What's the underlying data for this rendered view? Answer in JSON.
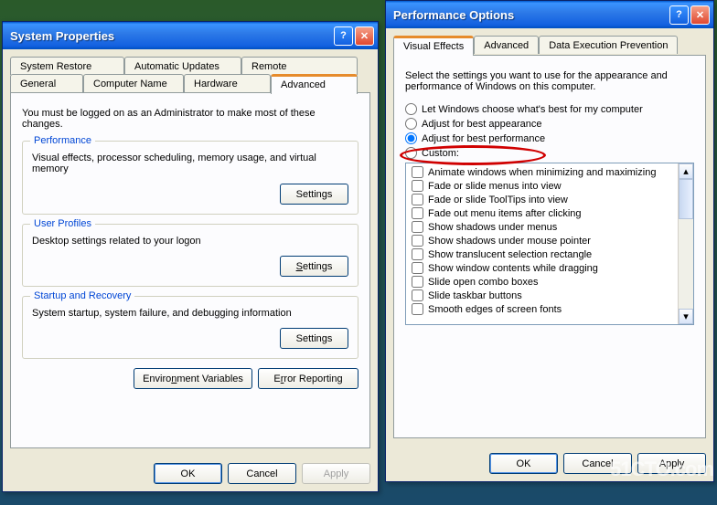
{
  "sysProps": {
    "title": "System Properties",
    "tabs_row1": [
      "System Restore",
      "Automatic Updates",
      "Remote"
    ],
    "tabs_row2": [
      "General",
      "Computer Name",
      "Hardware",
      "Advanced"
    ],
    "instruction": "You must be logged on as an Administrator to make most of these changes.",
    "groups": {
      "performance": {
        "title": "Performance",
        "desc": "Visual effects, processor scheduling, memory usage, and virtual memory",
        "btn": "Settings"
      },
      "userProfiles": {
        "title": "User Profiles",
        "desc": "Desktop settings related to your logon",
        "btn": "Settings"
      },
      "startup": {
        "title": "Startup and Recovery",
        "desc": "System startup, system failure, and debugging information",
        "btn": "Settings"
      }
    },
    "envVars": "Environment Variables",
    "errorReport": "Error Reporting",
    "ok": "OK",
    "cancel": "Cancel",
    "apply": "Apply"
  },
  "perfOpts": {
    "title": "Performance Options",
    "tabs": [
      "Visual Effects",
      "Advanced",
      "Data Execution Prevention"
    ],
    "instruction": "Select the settings you want to use for the appearance and performance of Windows on this computer.",
    "radios": {
      "let": "Let Windows choose what's best for my computer",
      "appearance": "Adjust for best appearance",
      "performance": "Adjust for best performance",
      "custom": "Custom:"
    },
    "checks": [
      "Animate windows when minimizing and maximizing",
      "Fade or slide menus into view",
      "Fade or slide ToolTips into view",
      "Fade out menu items after clicking",
      "Show shadows under menus",
      "Show shadows under mouse pointer",
      "Show translucent selection rectangle",
      "Show window contents while dragging",
      "Slide open combo boxes",
      "Slide taskbar buttons",
      "Smooth edges of screen fonts"
    ],
    "ok": "OK",
    "cancel": "Cancel",
    "apply": "Apply"
  },
  "watermark": "51CTO.com"
}
